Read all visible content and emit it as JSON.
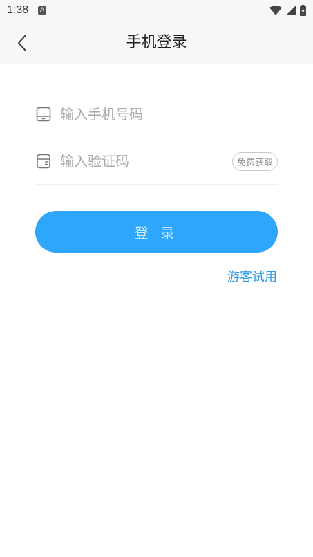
{
  "status_bar": {
    "time": "1:38",
    "notification_icon": "a-icon"
  },
  "header": {
    "title": "手机登录",
    "back_icon": "chevron-left-icon"
  },
  "form": {
    "phone": {
      "placeholder": "输入手机号码",
      "value": "",
      "icon": "phone-icon"
    },
    "code": {
      "placeholder": "输入验证码",
      "value": "",
      "icon": "document-icon",
      "send_button": "免费获取"
    }
  },
  "login_button": "登 录",
  "guest_link": "游客试用",
  "colors": {
    "accent": "#2ea6fc",
    "link": "#2a98e8",
    "button_text": "#d7ecfd"
  }
}
